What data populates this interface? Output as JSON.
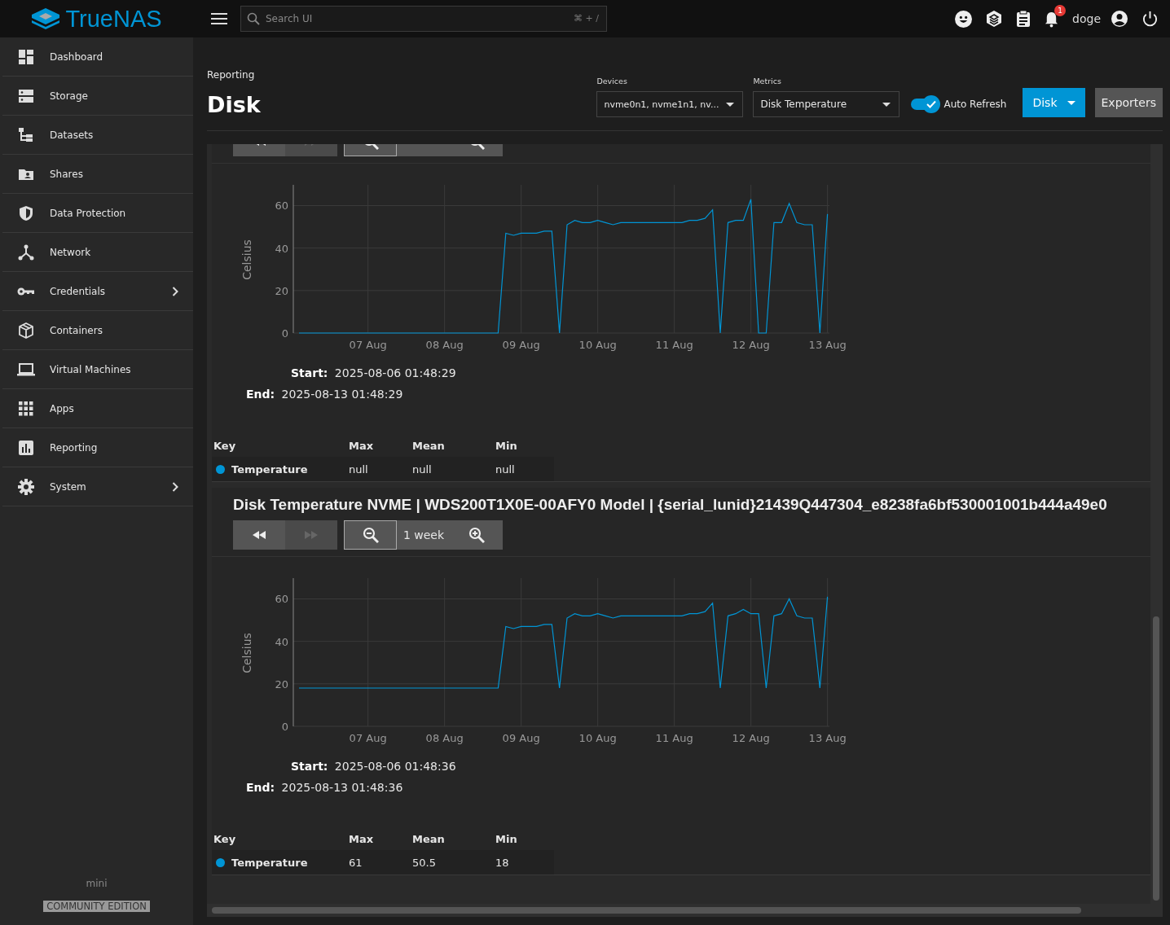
{
  "topbar": {
    "logo": "TrueNAS",
    "search": {
      "placeholder": "Search UI",
      "shortcut": "⌘ + /"
    },
    "notification_count": "1",
    "username": "doge"
  },
  "sidebar": {
    "items": [
      {
        "label": "Dashboard",
        "kind": "dashboard",
        "expandable": false
      },
      {
        "label": "Storage",
        "kind": "storage",
        "expandable": false
      },
      {
        "label": "Datasets",
        "kind": "datasets",
        "expandable": false
      },
      {
        "label": "Shares",
        "kind": "shares",
        "expandable": false
      },
      {
        "label": "Data Protection",
        "kind": "protection",
        "expandable": false
      },
      {
        "label": "Network",
        "kind": "network",
        "expandable": false
      },
      {
        "label": "Credentials",
        "kind": "credentials",
        "expandable": true
      },
      {
        "label": "Containers",
        "kind": "containers",
        "expandable": false
      },
      {
        "label": "Virtual Machines",
        "kind": "vms",
        "expandable": false
      },
      {
        "label": "Apps",
        "kind": "apps",
        "expandable": false
      },
      {
        "label": "Reporting",
        "kind": "reporting",
        "expandable": false
      },
      {
        "label": "System",
        "kind": "system",
        "expandable": true
      }
    ],
    "footer": {
      "hostname": "mini",
      "edition": "COMMUNITY EDITION"
    }
  },
  "page": {
    "breadcrumb": "Reporting",
    "title": "Disk",
    "devices": {
      "label": "Devices",
      "value": "nvme0n1, nvme1n1, nv..."
    },
    "metrics": {
      "label": "Metrics",
      "value": "Disk Temperature"
    },
    "auto_refresh": {
      "label": "Auto Refresh",
      "on": true
    },
    "type_button": "Disk",
    "exporters_button": "Exporters"
  },
  "cards": [
    {
      "next_disabled": true,
      "chart_data": {
        "type": "line",
        "grid": true,
        "ylabel": "Celsius",
        "ylim": [
          0,
          69
        ],
        "yticks": [
          0,
          20,
          40,
          60
        ],
        "categories": [
          null,
          null,
          null,
          null,
          null,
          null,
          null,
          null,
          null,
          "07 Aug",
          null,
          null,
          null,
          null,
          null,
          null,
          null,
          null,
          null,
          "08 Aug",
          null,
          null,
          null,
          null,
          null,
          null,
          null,
          null,
          null,
          "09 Aug",
          null,
          null,
          null,
          null,
          null,
          null,
          null,
          null,
          null,
          "10 Aug",
          null,
          null,
          null,
          null,
          null,
          null,
          null,
          null,
          null,
          "11 Aug",
          null,
          null,
          null,
          null,
          null,
          null,
          null,
          null,
          null,
          "12 Aug",
          null,
          null,
          null,
          null,
          null,
          null,
          null,
          null,
          null,
          "13 Aug"
        ],
        "series": [
          {
            "color": "#0095d5",
            "values": [
              0,
              0,
              0,
              0,
              0,
              0,
              0,
              0,
              0,
              0,
              0,
              0,
              0,
              0,
              0,
              0,
              0,
              0,
              0,
              0,
              0,
              0,
              0,
              0,
              0,
              0,
              0,
              47,
              46,
              47,
              47,
              47,
              48,
              48,
              0,
              51,
              53,
              52,
              52,
              53,
              52,
              51,
              52,
              52,
              52,
              52,
              52,
              52,
              52,
              52,
              52,
              53,
              53,
              54,
              58,
              0,
              52,
              53,
              53,
              63,
              0,
              0,
              52,
              52,
              61,
              52,
              51,
              51,
              0,
              56
            ]
          }
        ]
      },
      "start": {
        "label": "Start:",
        "value": "2025-08-06 01:48:29"
      },
      "end": {
        "label": "End:",
        "value": "2025-08-13 01:48:29"
      },
      "legend": {
        "columns": [
          "Key",
          "Max",
          "Mean",
          "Min"
        ],
        "rows": [
          {
            "name": "Temperature",
            "color": "#0095d5",
            "max": "null",
            "mean": "null",
            "min": "null"
          }
        ]
      }
    },
    {
      "title": "Disk Temperature NVME | WDS200T1X0E-00AFY0 Model | {serial_lunid}21439Q447304_e8238fa6bf530001001b444a49e0",
      "range_label": "1 week",
      "next_disabled": true,
      "chart_data": {
        "type": "line",
        "grid": true,
        "ylabel": "Celsius",
        "ylim": [
          0,
          69
        ],
        "yticks": [
          0,
          20,
          40,
          60
        ],
        "categories": [
          null,
          null,
          null,
          null,
          null,
          null,
          null,
          null,
          null,
          "07 Aug",
          null,
          null,
          null,
          null,
          null,
          null,
          null,
          null,
          null,
          "08 Aug",
          null,
          null,
          null,
          null,
          null,
          null,
          null,
          null,
          null,
          "09 Aug",
          null,
          null,
          null,
          null,
          null,
          null,
          null,
          null,
          null,
          "10 Aug",
          null,
          null,
          null,
          null,
          null,
          null,
          null,
          null,
          null,
          "11 Aug",
          null,
          null,
          null,
          null,
          null,
          null,
          null,
          null,
          null,
          "12 Aug",
          null,
          null,
          null,
          null,
          null,
          null,
          null,
          null,
          null,
          "13 Aug"
        ],
        "series": [
          {
            "color": "#0095d5",
            "values": [
              18,
              18,
              18,
              18,
              18,
              18,
              18,
              18,
              18,
              18,
              18,
              18,
              18,
              18,
              18,
              18,
              18,
              18,
              18,
              18,
              18,
              18,
              18,
              18,
              18,
              18,
              18,
              47,
              46,
              47,
              47,
              47,
              48,
              48,
              18,
              51,
              53,
              52,
              52,
              53,
              52,
              51,
              52,
              52,
              52,
              52,
              52,
              52,
              52,
              52,
              52,
              53,
              53,
              54,
              58,
              18,
              52,
              53,
              55,
              53,
              53,
              18,
              52,
              53,
              60,
              52,
              51,
              51,
              18,
              61
            ]
          }
        ]
      },
      "start": {
        "label": "Start:",
        "value": "2025-08-06 01:48:36"
      },
      "end": {
        "label": "End:",
        "value": "2025-08-13 01:48:36"
      },
      "legend": {
        "columns": [
          "Key",
          "Max",
          "Mean",
          "Min"
        ],
        "rows": [
          {
            "name": "Temperature",
            "color": "#0095d5",
            "max": "61",
            "mean": "50.5",
            "min": "18"
          }
        ]
      }
    }
  ]
}
